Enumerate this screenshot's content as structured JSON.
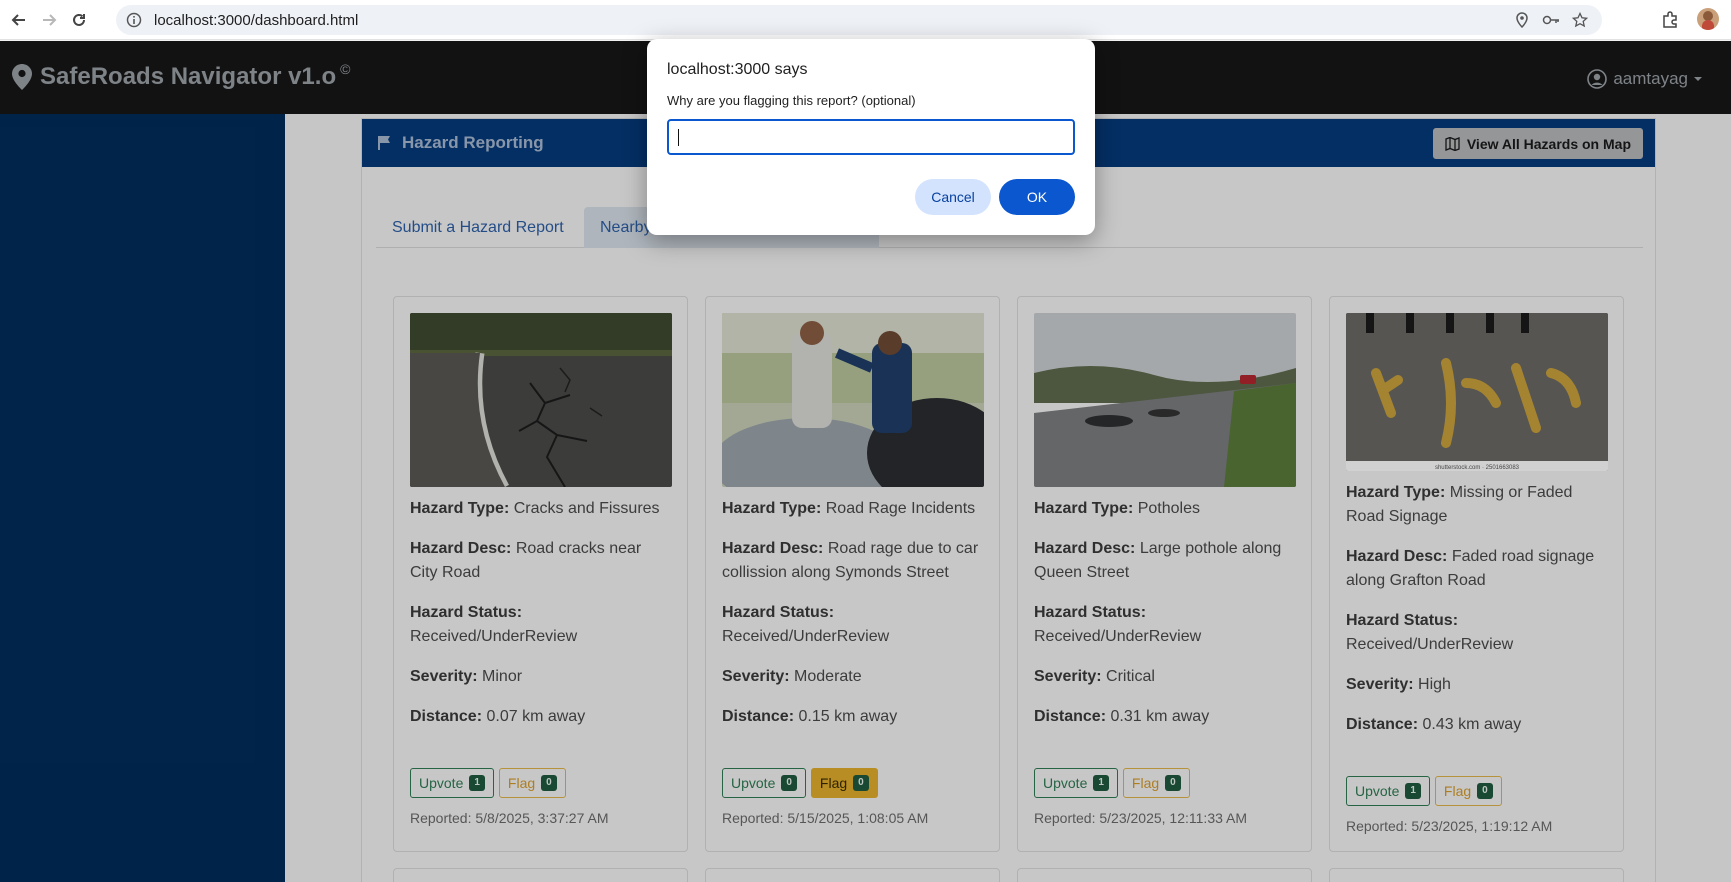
{
  "browser": {
    "url": "localhost:3000/dashboard.html"
  },
  "app": {
    "title": "SafeRoads Navigator v1.o",
    "copyright_symbol": "©",
    "username": "aamtayag"
  },
  "panel": {
    "title": "Hazard Reporting",
    "map_button": "View All Hazards on Map",
    "tabs": [
      {
        "label": "Submit a Hazard Report"
      },
      {
        "label": "Nearby"
      }
    ]
  },
  "labels": {
    "type": "Hazard Type:",
    "desc": "Hazard Desc:",
    "status": "Hazard Status:",
    "severity": "Severity:",
    "distance": "Distance:",
    "upvote": "Upvote",
    "flag": "Flag"
  },
  "cards": [
    {
      "type": "Cracks and Fissures",
      "desc": "Road cracks near City Road",
      "status": "Received/UnderReview",
      "severity": "Minor",
      "distance": "0.07 km away",
      "upvotes": "1",
      "flags": "0",
      "reported": "Reported: 5/8/2025, 3:37:27 AM"
    },
    {
      "type": "Road Rage Incidents",
      "desc": "Road rage due to car collission along Symonds Street",
      "status": "Received/UnderReview",
      "severity": "Moderate",
      "distance": "0.15 km away",
      "upvotes": "0",
      "flags": "0",
      "reported": "Reported: 5/15/2025, 1:08:05 AM"
    },
    {
      "type": "Potholes",
      "desc": "Large pothole along Queen Street",
      "status": "Received/UnderReview",
      "severity": "Critical",
      "distance": "0.31 km away",
      "upvotes": "1",
      "flags": "0",
      "reported": "Reported: 5/23/2025, 12:11:33 AM"
    },
    {
      "type": "Missing or Faded Road Signage",
      "desc": "Faded road signage along Grafton Road",
      "status": "Received/UnderReview",
      "severity": "High",
      "distance": "0.43 km away",
      "upvotes": "1",
      "flags": "0",
      "reported": "Reported: 5/23/2025, 1:19:12 AM",
      "photo_caption": "shutterstock.com · 2501663083"
    }
  ],
  "dialog": {
    "title": "localhost:3000 says",
    "message": "Why are you flagging this report? (optional)",
    "input_value": "",
    "cancel": "Cancel",
    "ok": "OK"
  }
}
